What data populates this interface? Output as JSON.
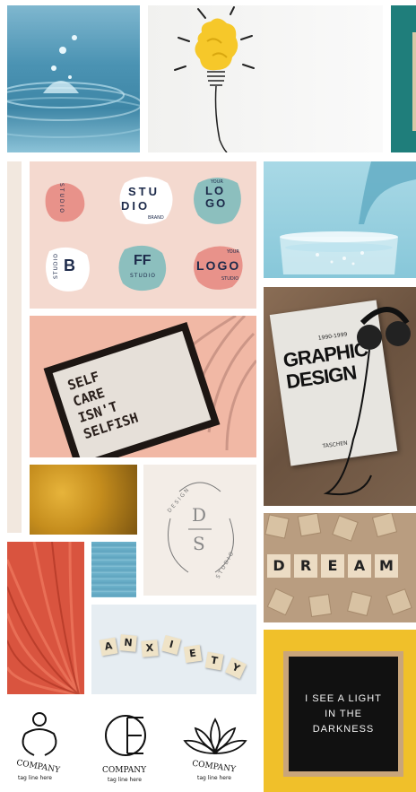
{
  "logos_panel": {
    "studio_vertical": "STUDIO",
    "studio_brand_top": "STU",
    "studio_brand_bottom": "DIO",
    "studio_brand_small": "BRAND",
    "your_logo_small": "YOUR",
    "your_logo_big": "LO\nGO",
    "studio_b_side": "STUDIO",
    "studio_b_letter": "B",
    "ff_letters": "FF",
    "ff_studio": "STUDIO",
    "logo_bottom": "LOGO",
    "logo_bottom_small": "YOUR",
    "logo_bottom_studio": "STUDIO"
  },
  "letter_board_pink": {
    "lines": [
      "SELF",
      "CARE",
      "ISN'T",
      "SELFISH"
    ]
  },
  "book": {
    "years": "1990-1999",
    "title_line1": "GRAPHIC",
    "title_line2": "DESIGN",
    "publisher": "TASCHEN"
  },
  "scrabble_dream": {
    "letters": [
      "D",
      "R",
      "E",
      "A",
      "M"
    ],
    "subscripts": [
      "2",
      "1",
      "1",
      "1",
      "3"
    ]
  },
  "ds_logo": {
    "top_arc": "DESIGN",
    "bottom_arc": "STUDIO",
    "letter_d": "D",
    "letter_s": "S"
  },
  "anxiety": {
    "letters": [
      "A",
      "N",
      "X",
      "I",
      "E",
      "T",
      "Y"
    ]
  },
  "black_board": {
    "lines": [
      "I SEE A LIGHT",
      "IN THE",
      "DARKNESS"
    ]
  },
  "company_logos": [
    {
      "name": "COMPANY",
      "tagline": "tag line here"
    },
    {
      "name": "COMPANY",
      "tagline": "tag line here"
    },
    {
      "name": "COMPANY",
      "tagline": "tag line here"
    }
  ]
}
